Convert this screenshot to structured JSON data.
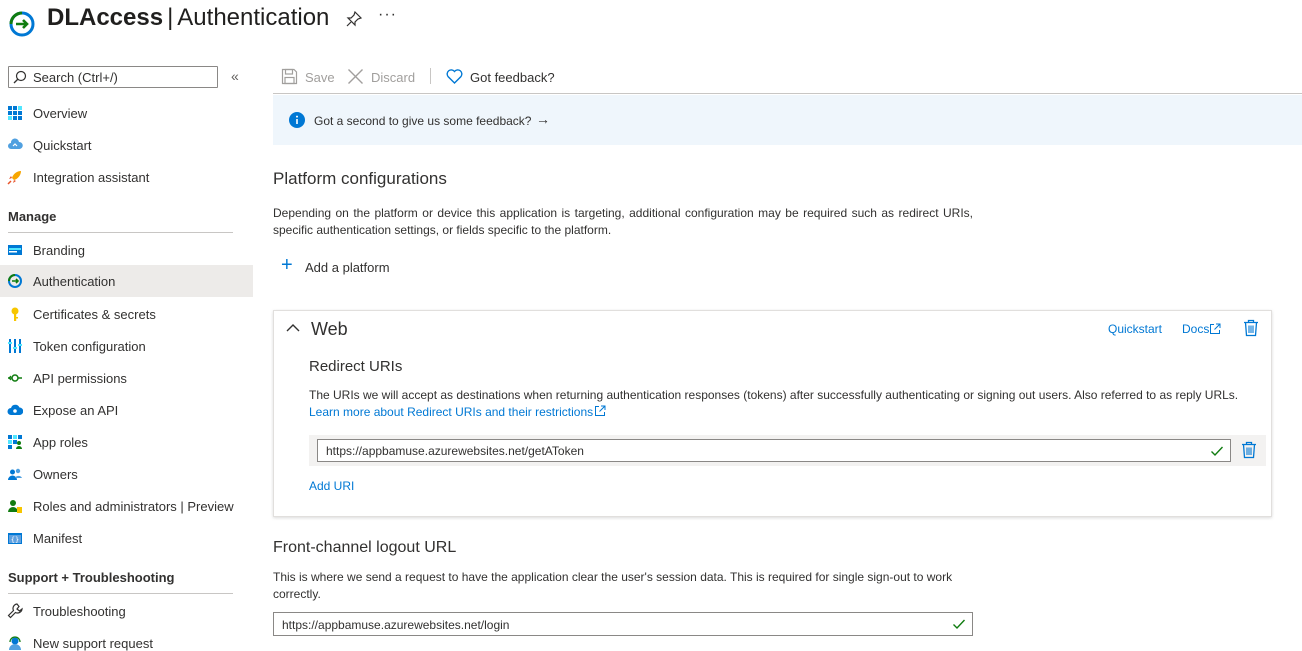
{
  "header": {
    "app_name": "DLAccess",
    "separator": "|",
    "page_title": "Authentication",
    "more_label": "···"
  },
  "sidebar": {
    "search_placeholder": "Search (Ctrl+/)",
    "collapse_label": "«",
    "top_items": [
      {
        "label": "Overview",
        "icon": "overview-icon"
      },
      {
        "label": "Quickstart",
        "icon": "quickstart-icon"
      },
      {
        "label": "Integration assistant",
        "icon": "rocket-icon"
      }
    ],
    "manage_title": "Manage",
    "manage_items": [
      {
        "label": "Branding",
        "icon": "branding-icon"
      },
      {
        "label": "Authentication",
        "icon": "authentication-icon",
        "active": true
      },
      {
        "label": "Certificates & secrets",
        "icon": "key-icon"
      },
      {
        "label": "Token configuration",
        "icon": "token-icon"
      },
      {
        "label": "API permissions",
        "icon": "api-permissions-icon"
      },
      {
        "label": "Expose an API",
        "icon": "cloud-icon"
      },
      {
        "label": "App roles",
        "icon": "app-roles-icon"
      },
      {
        "label": "Owners",
        "icon": "owners-icon"
      },
      {
        "label": "Roles and administrators | Preview",
        "icon": "roles-admin-icon"
      },
      {
        "label": "Manifest",
        "icon": "manifest-icon"
      }
    ],
    "support_title": "Support + Troubleshooting",
    "support_items": [
      {
        "label": "Troubleshooting",
        "icon": "wrench-icon"
      },
      {
        "label": "New support request",
        "icon": "support-icon"
      }
    ]
  },
  "toolbar": {
    "save_label": "Save",
    "discard_label": "Discard",
    "feedback_label": "Got feedback?"
  },
  "banner": {
    "text": "Got a second to give us some feedback?",
    "arrow": "→"
  },
  "platform": {
    "title": "Platform configurations",
    "description": "Depending on the platform or device this application is targeting, additional configuration may be required such as redirect URIs, specific authentication settings, or fields specific to the platform.",
    "add_label": "Add a platform"
  },
  "web_card": {
    "title": "Web",
    "quickstart_link": "Quickstart",
    "docs_link": "Docs",
    "redirect_title": "Redirect URIs",
    "redirect_desc": "The URIs we will accept as destinations when returning authentication responses (tokens) after successfully authenticating or signing out users. Also referred to as reply URLs.",
    "learn_more_link": "Learn more about Redirect URIs and their restrictions",
    "redirect_uri_value": "https://appbamuse.azurewebsites.net/getAToken",
    "add_uri_label": "Add URI"
  },
  "logout": {
    "title": "Front-channel logout URL",
    "description": "This is where we send a request to have the application clear the user's session data. This is required for single sign-out to work correctly.",
    "value": "https://appbamuse.azurewebsites.net/login"
  },
  "colors": {
    "accent": "#0078d4",
    "success": "#107c10",
    "active_bg": "#edebe9",
    "banner_bg": "#eff6fc"
  }
}
